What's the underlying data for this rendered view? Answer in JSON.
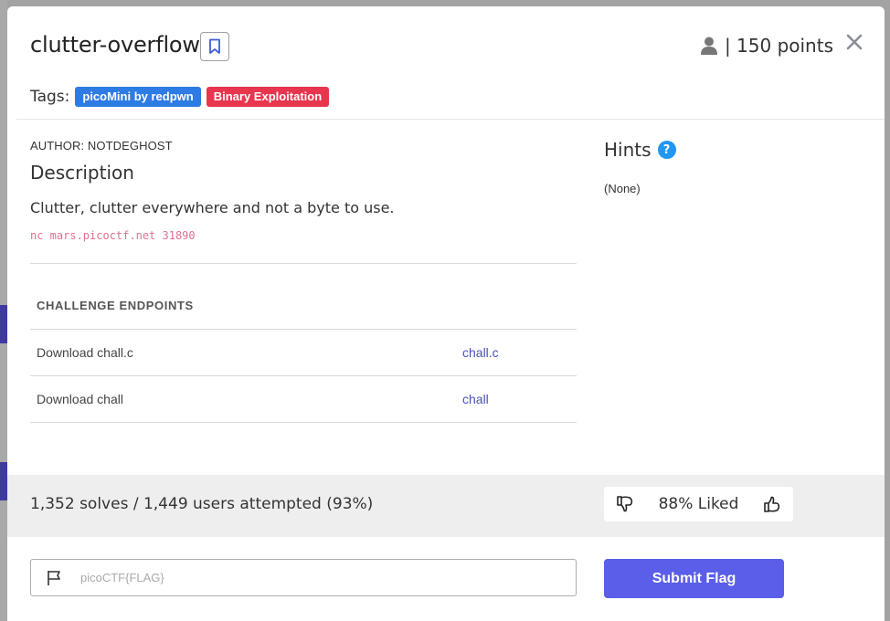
{
  "challenge": {
    "title": "clutter-overflow",
    "points_text": "| 150 points"
  },
  "tags": {
    "label": "Tags:",
    "items": [
      {
        "label": "picoMini by redpwn",
        "color": "#2d7be5"
      },
      {
        "label": "Binary Exploitation",
        "color": "#e8364f"
      }
    ]
  },
  "details": {
    "author": "AUTHOR: NOTDEGHOST",
    "description_heading": "Description",
    "description": "Clutter, clutter everywhere and not a byte to use.",
    "command": "nc mars.picoctf.net 31890"
  },
  "endpoints": {
    "heading": "CHALLENGE ENDPOINTS",
    "rows": [
      {
        "label": "Download chall.c",
        "link": "chall.c"
      },
      {
        "label": "Download chall",
        "link": "chall"
      }
    ]
  },
  "hints": {
    "heading": "Hints",
    "text": "(None)"
  },
  "stats": {
    "solves": "1,352 solves / 1,449 users attempted (93%)",
    "liked": "88% Liked"
  },
  "flag": {
    "placeholder": "picoCTF{FLAG}",
    "submit_label": "Submit Flag"
  },
  "colors": {
    "accent": "#5a5ee8",
    "tag_blue": "#2d7be5",
    "tag_red": "#e8364f",
    "link": "#4a52b8"
  }
}
